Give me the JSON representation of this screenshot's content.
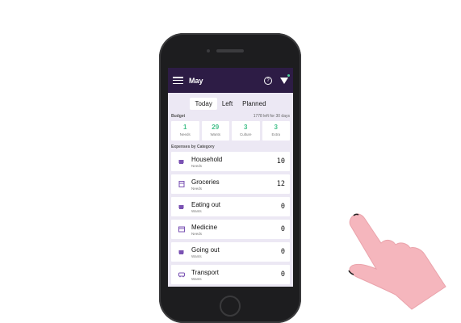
{
  "header": {
    "title": "May"
  },
  "tabs": [
    {
      "label": "Today",
      "active": true
    },
    {
      "label": "Left",
      "active": false
    },
    {
      "label": "Planned",
      "active": false
    }
  ],
  "budget": {
    "label": "Budget",
    "left_text": "1778 left for 30 days",
    "cards": [
      {
        "value": "1",
        "name": "Needs"
      },
      {
        "value": "29",
        "name": "Wants"
      },
      {
        "value": "3",
        "name": "Culture"
      },
      {
        "value": "3",
        "name": "Extra"
      }
    ]
  },
  "expenses": {
    "label": "Expenses by Category",
    "items": [
      {
        "name": "Household",
        "type": "Needs",
        "amount": "10",
        "icon": "household-icon"
      },
      {
        "name": "Groceries",
        "type": "Needs",
        "amount": "12",
        "icon": "groceries-icon"
      },
      {
        "name": "Eating out",
        "type": "Wants",
        "amount": "0",
        "icon": "eating-out-icon"
      },
      {
        "name": "Medicine",
        "type": "Needs",
        "amount": "0",
        "icon": "medicine-icon"
      },
      {
        "name": "Going out",
        "type": "Wants",
        "amount": "0",
        "icon": "going-out-icon"
      },
      {
        "name": "Transport",
        "type": "Wants",
        "amount": "0",
        "icon": "transport-icon"
      }
    ]
  },
  "colors": {
    "appbar": "#2d1c45",
    "accent_green": "#43c08a",
    "icon_purple": "#7a52b3",
    "screen_bg": "#ece8f4"
  }
}
